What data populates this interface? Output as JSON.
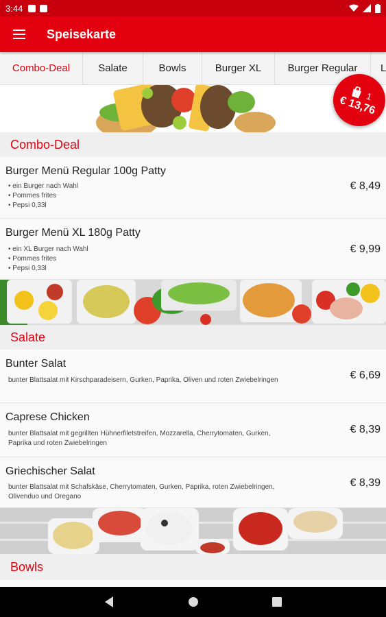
{
  "status_bar": {
    "time": "3:44"
  },
  "app_bar": {
    "title": "Speisekarte"
  },
  "tabs": [
    {
      "label": "Combo-Deal",
      "active": true
    },
    {
      "label": "Salate"
    },
    {
      "label": "Bowls"
    },
    {
      "label": "Burger XL"
    },
    {
      "label": "Burger Regular"
    },
    {
      "label": "L"
    }
  ],
  "cart": {
    "count": "1",
    "total": "€ 13,76"
  },
  "sections": {
    "combo": {
      "title": "Combo-Deal",
      "items": [
        {
          "name": "Burger Menü Regular 100g Patty",
          "desc_lines": [
            "• ein Burger nach Wahl",
            "• Pommes frites",
            "• Pepsi 0,33l"
          ],
          "price": "€ 8,49"
        },
        {
          "name": "Burger Menü XL 180g Patty",
          "desc_lines": [
            "• ein XL Burger nach Wahl",
            "• Pommes frites",
            "• Pepsi 0,33l"
          ],
          "price": "€ 9,99"
        }
      ]
    },
    "salate": {
      "title": "Salate",
      "items": [
        {
          "name": "Bunter Salat",
          "desc": "bunter Blattsalat mit Kirschparadeisern, Gurken, Paprika, Oliven und roten Zwiebelringen",
          "price": "€ 6,69"
        },
        {
          "name": "Caprese Chicken",
          "desc": "bunter Blattsalat mit gegrillten Hühnerfiletstreifen, Mozzarella, Cherrytomaten, Gurken, Paprika und roten Zwiebelringen",
          "price": "€ 8,39"
        },
        {
          "name": "Griechischer Salat",
          "desc": "bunter Blattsalat mit Schafskäse, Cherrytomaten, Gurken, Paprika, roten Zwiebelringen, Olivenduo und Oregano",
          "price": "€ 8,39"
        }
      ]
    },
    "bowls": {
      "title": "Bowls"
    }
  },
  "colors": {
    "primary": "#e3000f",
    "statusbar": "#c8000e"
  }
}
